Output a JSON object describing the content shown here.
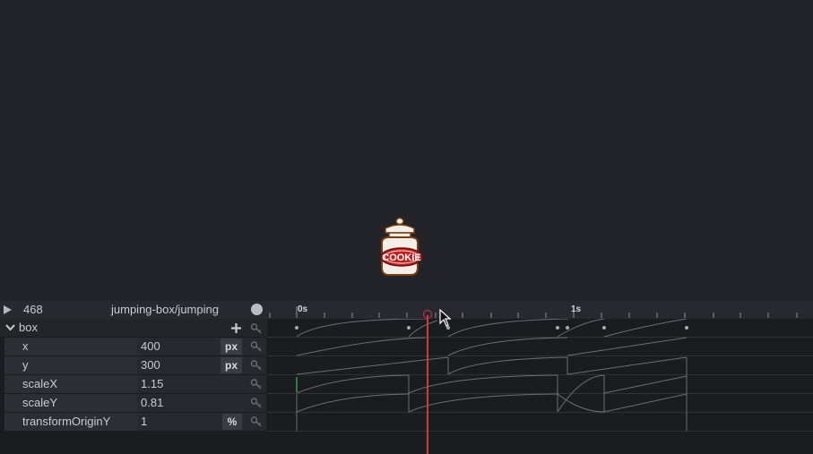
{
  "timeline": {
    "frame": "468",
    "sequence_name": "jumping-box/jumping",
    "ruler_labels": [
      "0s",
      "1s"
    ]
  },
  "object": {
    "name": "box",
    "properties": [
      {
        "name": "x",
        "value": "400",
        "unit": "px"
      },
      {
        "name": "y",
        "value": "300",
        "unit": "px"
      },
      {
        "name": "scaleX",
        "value": "1.15",
        "unit": ""
      },
      {
        "name": "scaleY",
        "value": "0.81",
        "unit": ""
      },
      {
        "name": "transformOriginY",
        "value": "1",
        "unit": "%"
      }
    ]
  },
  "stage": {
    "logo_text": "COOKIE"
  },
  "icons": {
    "play": "play-icon",
    "record": "record-icon",
    "add": "plus-icon",
    "expand": "chevron-down-icon",
    "keyframe": "key-icon"
  },
  "colors": {
    "playhead": "#d13a3a",
    "logo_red": "#c81e1e"
  }
}
